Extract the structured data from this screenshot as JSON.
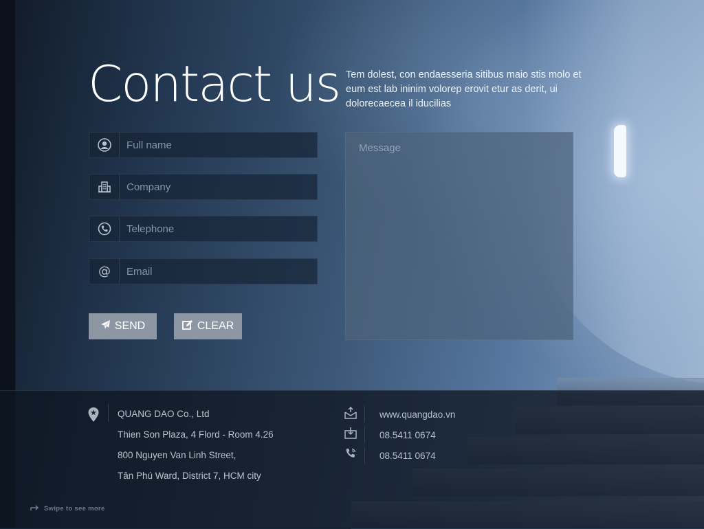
{
  "page": {
    "title": "Contact us",
    "intro": "Tem dolest, con endaesseria sitibus maio stis molo et eum est lab ininim volorep erovit etur as derit, ui dolorecaecea il iducilias"
  },
  "form": {
    "fields": [
      {
        "name": "full-name",
        "icon": "user-icon",
        "placeholder": "Full name"
      },
      {
        "name": "company",
        "icon": "building-icon",
        "placeholder": "Company"
      },
      {
        "name": "telephone",
        "icon": "phone-icon",
        "placeholder": "Telephone"
      },
      {
        "name": "email",
        "icon": "at-icon",
        "placeholder": "Email"
      }
    ],
    "message_placeholder": "Message",
    "send_label": "SEND",
    "clear_label": "CLEAR"
  },
  "footer": {
    "address": [
      "QUANG DAO Co., Ltd",
      "Thien Son Plaza, 4 Flord - Room 4.26",
      "800 Nguyen Van Linh Street,",
      "Tân Phú Ward, District 7, HCM city"
    ],
    "contacts": [
      {
        "icon": "mail-icon",
        "text": "www.quangdao.vn"
      },
      {
        "icon": "fax-icon",
        "text": "08.5411 0674"
      },
      {
        "icon": "phone-icon",
        "text": "08.5411 0674"
      }
    ],
    "swipe_hint": "Swipe to see more"
  },
  "colors": {
    "button_bg": "#8d97a4",
    "field_bg": "#16243a",
    "message_bg": "#4e627c"
  }
}
